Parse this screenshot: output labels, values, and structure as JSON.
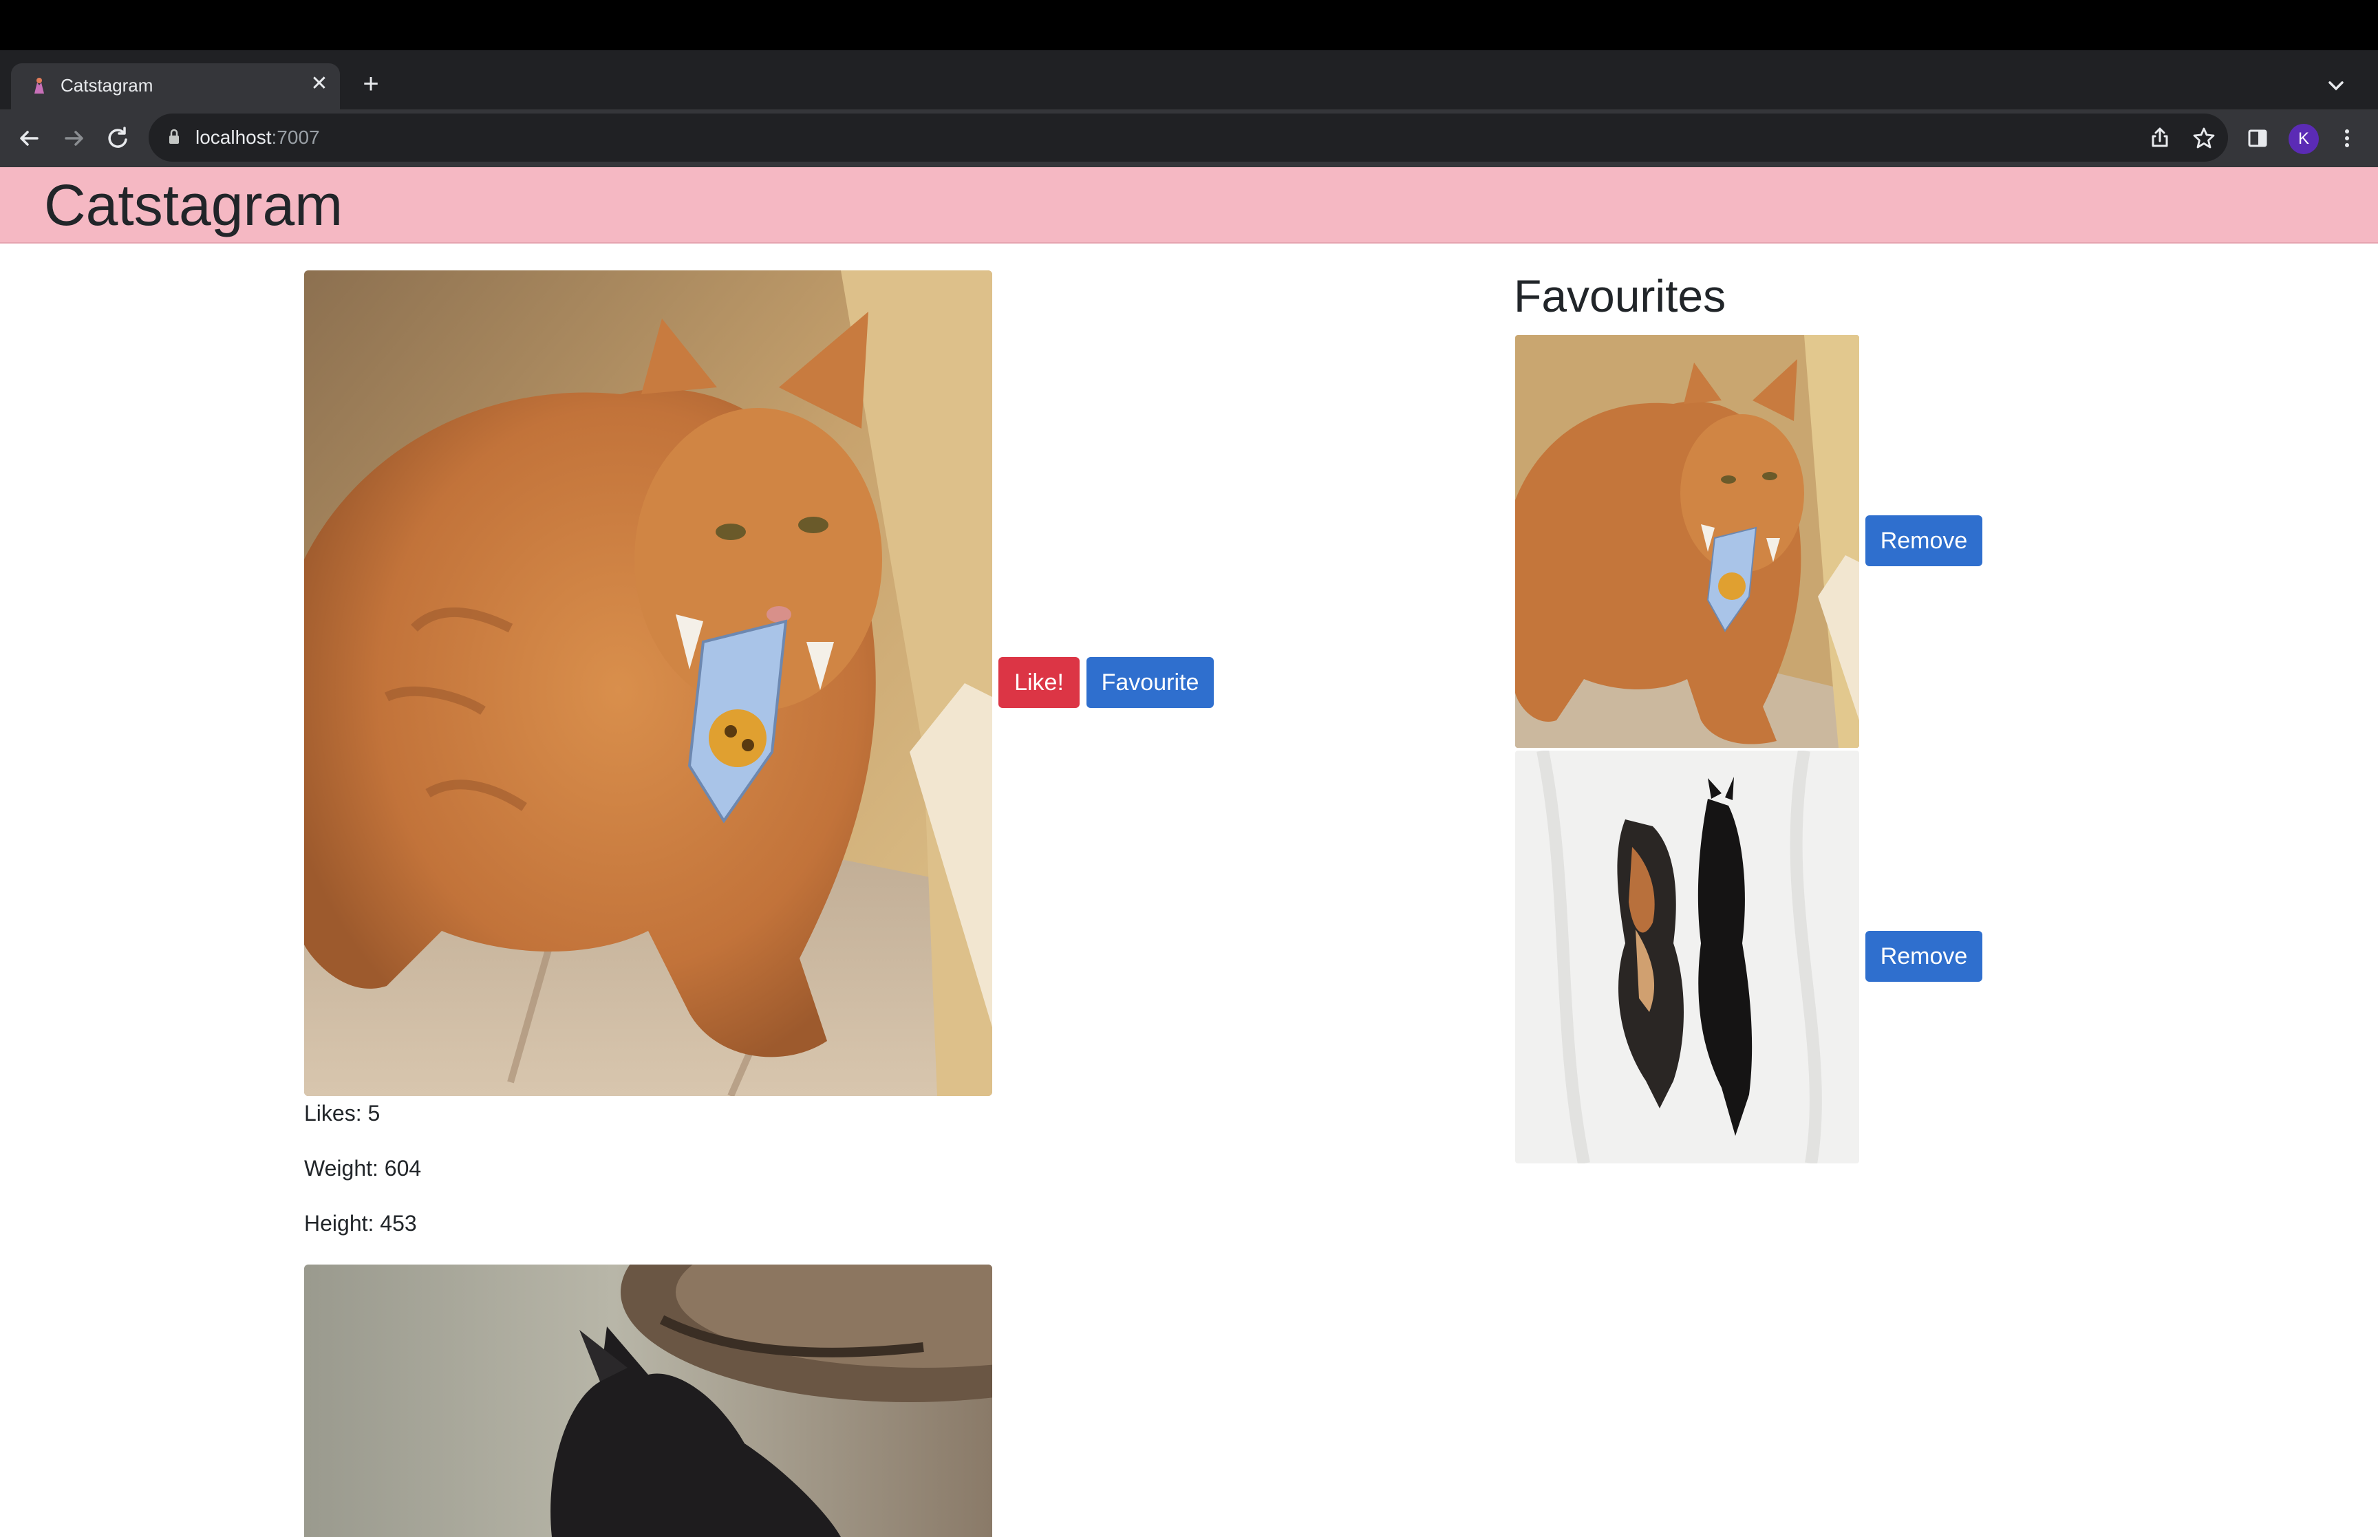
{
  "browser": {
    "tab_title": "Catstagram",
    "tab_close": "✕",
    "new_tab": "+",
    "tab_menu": "⌄",
    "url_host": "localhost",
    "url_port": ":7007",
    "avatar_initial": "K",
    "icons": [
      "back-icon",
      "forward-icon",
      "reload-icon",
      "lock-icon",
      "share-icon",
      "bookmark-star-icon",
      "side-panel-icon",
      "menu-kebab-icon"
    ]
  },
  "header": {
    "brand": "Catstagram",
    "background": "#f5b8c3"
  },
  "feed": {
    "posts": [
      {
        "like_label": "Like!",
        "favourite_label": "Favourite",
        "likes": "Likes: 5",
        "weight": "Weight: 604",
        "height": "Height: 453"
      }
    ]
  },
  "favourites": {
    "title": "Favourites",
    "items": [
      {
        "remove_label": "Remove"
      },
      {
        "remove_label": "Remove"
      }
    ]
  },
  "colors": {
    "like": "#dc3545",
    "primary": "#2f6fce",
    "header": "#f5b8c3"
  }
}
